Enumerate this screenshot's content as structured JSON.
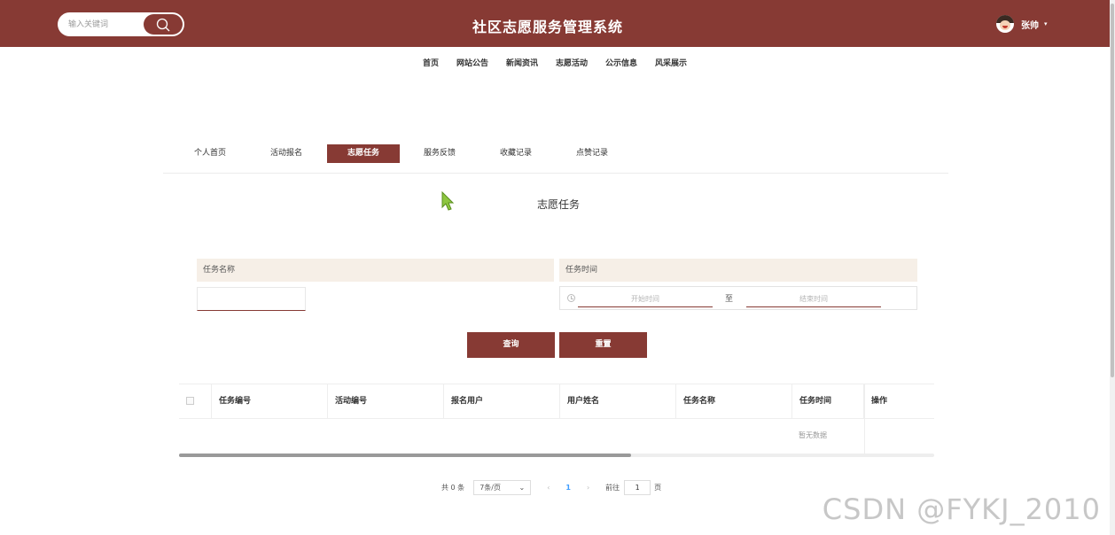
{
  "header": {
    "title": "社区志愿服务管理系统",
    "search_placeholder": "输入关键词",
    "search_icon": "search-icon",
    "user_name": "张帅",
    "user_caret": "▾",
    "brand_color": "#873a34"
  },
  "nav": [
    "首页",
    "网站公告",
    "新闻资讯",
    "志愿活动",
    "公示信息",
    "风采展示"
  ],
  "tabs": [
    {
      "label": "个人首页",
      "active": false
    },
    {
      "label": "活动报名",
      "active": false
    },
    {
      "label": "志愿任务",
      "active": true
    },
    {
      "label": "服务反馈",
      "active": false
    },
    {
      "label": "收藏记录",
      "active": false
    },
    {
      "label": "点赞记录",
      "active": false
    }
  ],
  "section_title": "志愿任务",
  "filters": {
    "task_name_label": "任务名称",
    "task_name_value": "",
    "task_time_label": "任务时间",
    "start_placeholder": "开始时间",
    "range_separator": "至",
    "end_placeholder": "结束时间"
  },
  "buttons": {
    "query": "查询",
    "reset": "重置"
  },
  "table": {
    "columns": [
      "任务编号",
      "活动编号",
      "报名用户",
      "用户姓名",
      "任务名称",
      "任务时间",
      "操作"
    ],
    "rows": [],
    "empty_text": "暂无数据"
  },
  "pagination": {
    "total": "共 0 条",
    "page_size": "7条/页",
    "prev": "‹",
    "current_page": "1",
    "next": "›",
    "goto_label": "前往",
    "goto_value": "1",
    "goto_unit": "页"
  },
  "watermark": "CSDN @FYKJ_2010"
}
